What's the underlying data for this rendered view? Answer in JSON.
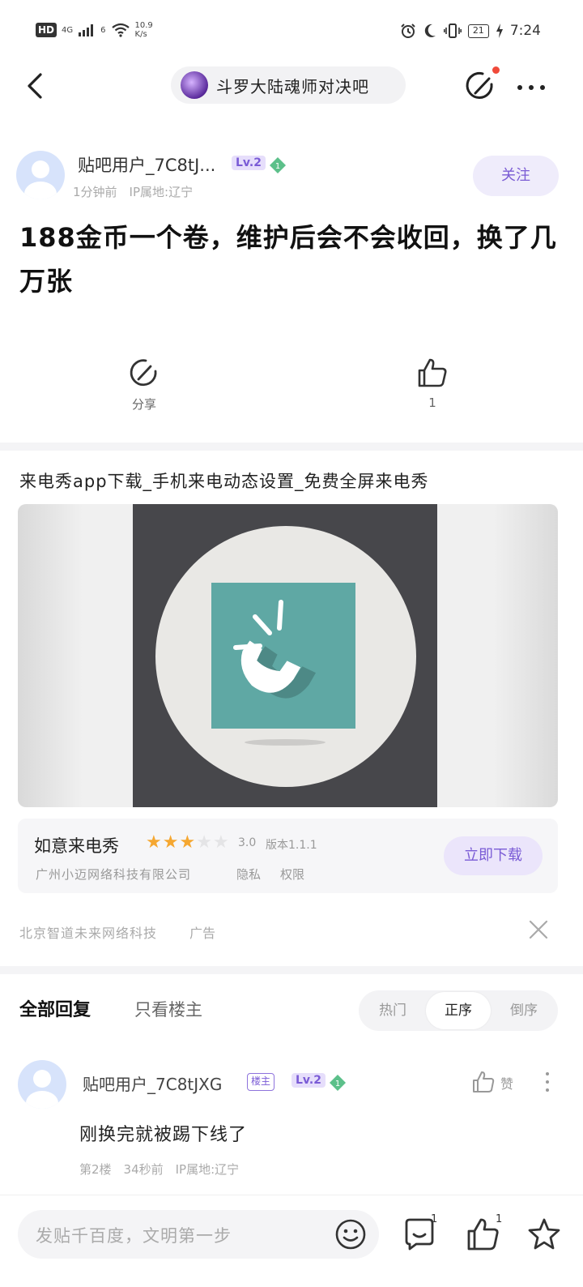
{
  "status_bar": {
    "left_hd": "HD",
    "left_network": "4G",
    "left_wifi_label": "6",
    "left_speed_value": "10.9",
    "left_speed_unit": "K/s",
    "battery": "21",
    "time": "7:24"
  },
  "header": {
    "forum_name": "斗罗大陆魂师对决吧"
  },
  "post": {
    "author_name": "贴吧用户_7C8tJ...",
    "author_level": "Lv.2",
    "gem_level": "1",
    "meta": "1分钟前　IP属地:辽宁",
    "follow_label": "关注",
    "title": "188金币一个卷，维护后会不会收回，换了几万张"
  },
  "actions": {
    "share_label": "分享",
    "like_count": "1"
  },
  "ad": {
    "title": "来电秀app下载_手机来电动态设置_免费全屏来电秀",
    "app_name": "如意来电秀",
    "rating": "3.0",
    "rating_value": 3,
    "version": "版本1.1.1",
    "company": "广州小迈网络科技有限公司",
    "privacy": "隐私",
    "permissions": "权限",
    "download_label": "立即下载",
    "source": "北京智道未来网络科技",
    "ad_tag": "广告",
    "image_colors": {
      "teal": "#5fa8a4",
      "dark": "#47474b",
      "circle": "#e9e8e5"
    }
  },
  "replies": {
    "tab_all": "全部回复",
    "tab_owner": "只看楼主",
    "sort": [
      "热门",
      "正序",
      "倒序"
    ],
    "sort_active": "正序",
    "items": [
      {
        "name": "贴吧用户_7C8tJXG",
        "owner_badge": "楼主",
        "level": "Lv.2",
        "gem_level": "1",
        "like_label": "赞",
        "content": "刚换完就被踢下线了",
        "meta": "第2楼　34秒前　IP属地:辽宁"
      }
    ]
  },
  "bottom_bar": {
    "compose_placeholder": "发贴千百度，文明第一步",
    "comment_count": "1",
    "like_count": "1"
  },
  "colors": {
    "accent": "#7a5bd6",
    "accent_bg": "#efecfb",
    "star": "#f5a731",
    "notify_dot": "#f04a3a",
    "gem": "#5cc08a"
  }
}
